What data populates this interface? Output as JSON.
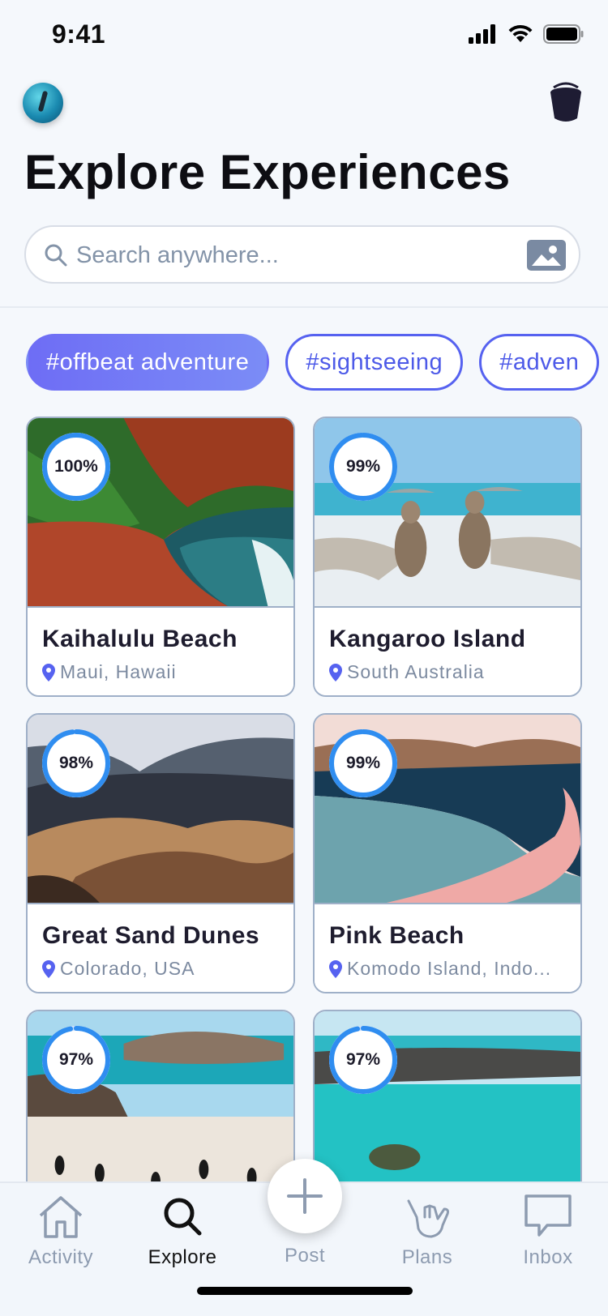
{
  "status": {
    "time": "9:41"
  },
  "header": {
    "title": "Explore Experiences",
    "search_placeholder": "Search anywhere..."
  },
  "tags": [
    "#offbeat adventure",
    "#sightseeing",
    "#adven"
  ],
  "cards": [
    {
      "title": "Kaihalulu Beach",
      "location": "Maui, Hawaii",
      "match": "100%",
      "match_value": 1.0
    },
    {
      "title": "Kangaroo Island",
      "location": "South Australia",
      "match": "99%",
      "match_value": 0.99
    },
    {
      "title": "Great Sand Dunes",
      "location": "Colorado, USA",
      "match": "98%",
      "match_value": 0.98
    },
    {
      "title": "Pink Beach",
      "location": "Komodo Island, Indo...",
      "match": "99%",
      "match_value": 0.99
    },
    {
      "title": "",
      "location": "",
      "match": "97%",
      "match_value": 0.97
    },
    {
      "title": "",
      "location": "",
      "match": "97%",
      "match_value": 0.97
    }
  ],
  "tabbar": {
    "activity": "Activity",
    "explore": "Explore",
    "post": "Post",
    "plans": "Plans",
    "inbox": "Inbox"
  },
  "colors": {
    "accent": "#5662f0",
    "match_ring": "#2f8df0",
    "pin": "#5662f0"
  }
}
